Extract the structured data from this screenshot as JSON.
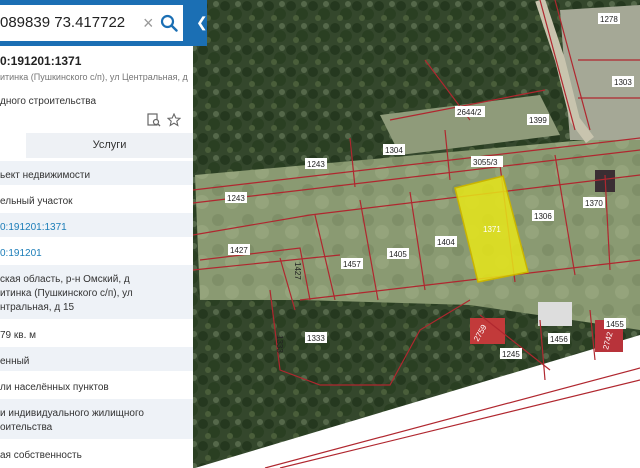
{
  "search": {
    "value": "089839 73.417722"
  },
  "panel": {
    "cadastral_number": "0:191201:1371",
    "address_line": "итинка (Пушкинского с/п), ул Центральная, д",
    "purpose": "дного строительства",
    "tabs": {
      "services": "Услуги"
    },
    "rows": [
      {
        "lines": [
          "ьект недвижимости"
        ]
      },
      {
        "lines": [
          "ельный участок"
        ]
      },
      {
        "lines": [
          "0:191201:1371"
        ],
        "link": true
      },
      {
        "lines": [
          "0:191201"
        ],
        "link": true
      },
      {
        "lines": [
          "ская область, р-н Омский, д",
          "итинка (Пушкинского с/п), ул",
          "нтральная, д 15"
        ]
      },
      {
        "lines": [
          "79 кв. м"
        ]
      },
      {
        "lines": [
          "енный"
        ]
      },
      {
        "lines": [
          "ли населённых пунктов"
        ]
      },
      {
        "lines": [
          "и индивидуального жилищного",
          "оительства"
        ]
      },
      {
        "lines": [
          "ая собственность"
        ]
      }
    ]
  },
  "map": {
    "colors": {
      "parcel_border": "#b0272f",
      "selected_fill": "#e6e619",
      "selected_stroke": "#c9b400"
    },
    "labels": [
      "1278",
      "1303",
      "2644/2",
      "1399",
      "1243",
      "1304",
      "3055/3",
      "1243",
      "1371",
      "1306",
      "1370",
      "1427",
      "1457",
      "1405",
      "1404",
      "1427",
      "1333",
      "1333",
      "2759",
      "1245",
      "1456",
      "2742",
      "1455"
    ]
  }
}
